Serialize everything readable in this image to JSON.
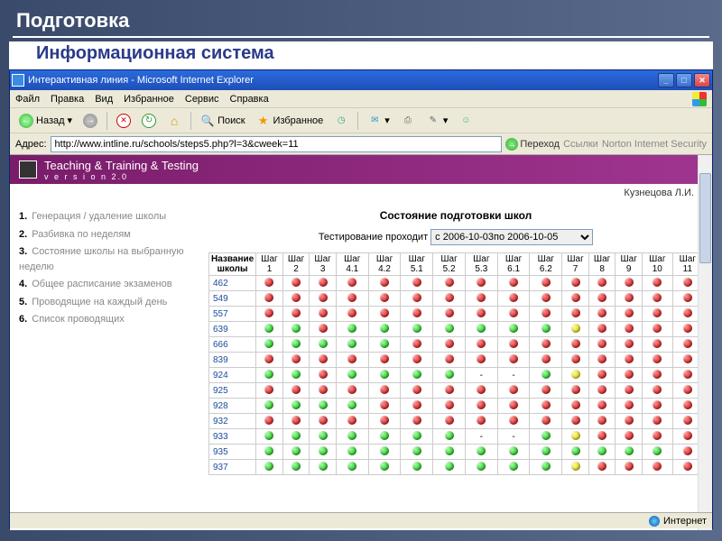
{
  "slide": {
    "title": "Подготовка",
    "subtitle": "Информационная система"
  },
  "window": {
    "title": "Интерактивная линия - Microsoft Internet Explorer"
  },
  "menu": {
    "file": "Файл",
    "edit": "Правка",
    "view": "Вид",
    "favorites": "Избранное",
    "tools": "Сервис",
    "help": "Справка"
  },
  "toolbar": {
    "back": "Назад",
    "search": "Поиск",
    "favorites": "Избранное"
  },
  "address": {
    "label": "Адрес:",
    "url": "http://www.intline.ru/schools/steps5.php?l=3&cweek=11",
    "go": "Переход",
    "links": "Ссылки",
    "norton": "Norton Internet Security"
  },
  "app": {
    "title": "Teaching & Training & Testing",
    "version": "v e r s i o n  2.0",
    "username": "Кузнецова Л.И."
  },
  "sidebar": {
    "items": [
      "Генерация / удаление школы",
      "Разбивка по неделям",
      "Состояние школы на выбранную неделю",
      "Общее расписание экзаменов",
      "Проводящие на каждый день",
      "Список проводящих"
    ]
  },
  "panel": {
    "title": "Состояние подготовки школ",
    "filter_label": "Тестирование проходит",
    "filter_value": "с 2006-10-03по 2006-10-05"
  },
  "table": {
    "head": [
      "Название школы",
      "Шаг 1",
      "Шаг 2",
      "Шаг 3",
      "Шаг 4.1",
      "Шаг 4.2",
      "Шаг 5.1",
      "Шаг 5.2",
      "Шаг 5.3",
      "Шаг 6.1",
      "Шаг 6.2",
      "Шаг 7",
      "Шаг 8",
      "Шаг 9",
      "Шаг 10",
      "Шаг 11"
    ],
    "rows": [
      {
        "id": "462",
        "c": [
          "R",
          "R",
          "R",
          "R",
          "R",
          "R",
          "R",
          "R",
          "R",
          "R",
          "R",
          "R",
          "R",
          "R",
          "R"
        ]
      },
      {
        "id": "549",
        "c": [
          "R",
          "R",
          "R",
          "R",
          "R",
          "R",
          "R",
          "R",
          "R",
          "R",
          "R",
          "R",
          "R",
          "R",
          "R"
        ]
      },
      {
        "id": "557",
        "c": [
          "R",
          "R",
          "R",
          "R",
          "R",
          "R",
          "R",
          "R",
          "R",
          "R",
          "R",
          "R",
          "R",
          "R",
          "R"
        ]
      },
      {
        "id": "639",
        "c": [
          "G",
          "G",
          "R",
          "G",
          "G",
          "G",
          "G",
          "G",
          "G",
          "G",
          "Y",
          "R",
          "R",
          "R",
          "R"
        ]
      },
      {
        "id": "666",
        "c": [
          "G",
          "G",
          "G",
          "G",
          "G",
          "R",
          "R",
          "R",
          "R",
          "R",
          "R",
          "R",
          "R",
          "R",
          "R"
        ]
      },
      {
        "id": "839",
        "c": [
          "R",
          "R",
          "R",
          "R",
          "R",
          "R",
          "R",
          "R",
          "R",
          "R",
          "R",
          "R",
          "R",
          "R",
          "R"
        ]
      },
      {
        "id": "924",
        "c": [
          "G",
          "G",
          "R",
          "G",
          "G",
          "G",
          "G",
          "-",
          "-",
          "G",
          "Y",
          "R",
          "R",
          "R",
          "R"
        ]
      },
      {
        "id": "925",
        "c": [
          "R",
          "R",
          "R",
          "R",
          "R",
          "R",
          "R",
          "R",
          "R",
          "R",
          "R",
          "R",
          "R",
          "R",
          "R"
        ]
      },
      {
        "id": "928",
        "c": [
          "G",
          "G",
          "G",
          "G",
          "R",
          "R",
          "R",
          "R",
          "R",
          "R",
          "R",
          "R",
          "R",
          "R",
          "R"
        ]
      },
      {
        "id": "932",
        "c": [
          "R",
          "R",
          "R",
          "R",
          "R",
          "R",
          "R",
          "R",
          "R",
          "R",
          "R",
          "R",
          "R",
          "R",
          "R"
        ]
      },
      {
        "id": "933",
        "c": [
          "G",
          "G",
          "G",
          "G",
          "G",
          "G",
          "G",
          "-",
          "-",
          "G",
          "Y",
          "R",
          "R",
          "R",
          "R"
        ]
      },
      {
        "id": "935",
        "c": [
          "G",
          "G",
          "G",
          "G",
          "G",
          "G",
          "G",
          "G",
          "G",
          "G",
          "G",
          "G",
          "G",
          "G",
          "R"
        ]
      },
      {
        "id": "937",
        "c": [
          "G",
          "G",
          "G",
          "G",
          "G",
          "G",
          "G",
          "G",
          "G",
          "G",
          "Y",
          "R",
          "R",
          "R",
          "R"
        ]
      }
    ]
  },
  "status": {
    "zone": "Интернет"
  }
}
